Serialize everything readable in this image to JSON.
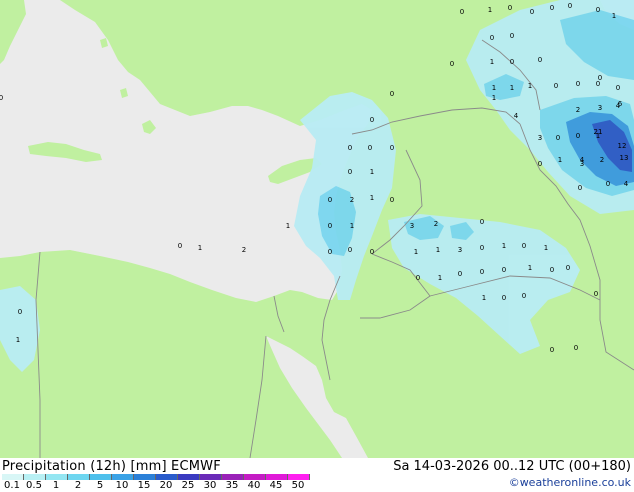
{
  "footer": {
    "title": "Precipitation (12h) [mm] ECMWF",
    "datetime": "Sa 14-03-2026 00..12 UTC (00+180)",
    "credit": "©weatheronline.co.uk"
  },
  "legend": {
    "ticks": [
      "0.1",
      "0.5",
      "1",
      "2",
      "5",
      "10",
      "15",
      "20",
      "25",
      "30",
      "35",
      "40",
      "45",
      "50"
    ],
    "colors": [
      "#d8f6f6",
      "#b8f0f4",
      "#94e6f2",
      "#6ed6f0",
      "#4ec0ec",
      "#3aa2e6",
      "#2b80d8",
      "#2a5ccc",
      "#3a3ac0",
      "#6a2ab8",
      "#9a22b8",
      "#c41cc4",
      "#e01ad8",
      "#ff20f0"
    ]
  },
  "colors": {
    "land": "#c0f0a0",
    "sea": "#ebebeb",
    "border": "#8a8a8a",
    "rain_light": "#b8ecf4",
    "rain_mid": "#7ad6f0",
    "rain_heavy": "#3a98e0",
    "rain_core": "#2a58c8"
  },
  "map": {
    "values": [
      "0",
      "1",
      "0",
      "0",
      "0",
      "0",
      "0",
      "1",
      "0",
      "0",
      "0",
      "1",
      "0",
      "0",
      "1",
      "1",
      "1",
      "0",
      "0",
      "0",
      "1",
      "4",
      "3",
      "0",
      "0",
      "1",
      "4",
      "0",
      "0",
      "2",
      "3",
      "6",
      "0",
      "1",
      "3",
      "21",
      "12",
      "4",
      "2",
      "13",
      "0",
      "0",
      "4",
      "0",
      "0",
      "0",
      "0",
      "0",
      "0",
      "1",
      "1",
      "0",
      "2",
      "0",
      "1",
      "0",
      "1",
      "3",
      "2",
      "0",
      "1",
      "1",
      "3",
      "0",
      "1",
      "0",
      "1",
      "0",
      "0",
      "0",
      "0",
      "0",
      "1",
      "2",
      "0",
      "1",
      "0",
      "0",
      "0",
      "1",
      "0",
      "1",
      "0",
      "0",
      "0",
      "0",
      "0",
      "0",
      "1",
      "0"
    ]
  }
}
